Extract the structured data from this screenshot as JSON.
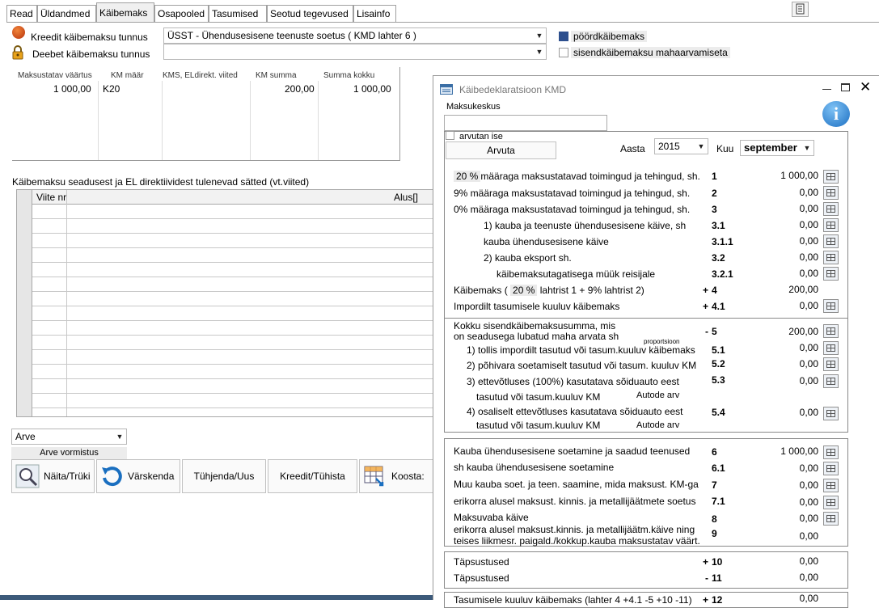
{
  "tabs": [
    "Read",
    "Üldandmed",
    "Käibemaks",
    "Osapooled",
    "Tasumised",
    "Seotud tegevused",
    "Lisainfo"
  ],
  "tax": {
    "credit_label": "Kreedit käibemaksu tunnus",
    "debit_label": "Deebet käibemaksu tunnus",
    "credit_value": "ÜSST - Ühendusesisene teenuste soetus ( KMD lahter 6 )",
    "debit_value": "",
    "reverse_label": "pöördkäibemaks",
    "reverse_checked": true,
    "input_vat_label": "sisendkäibemaksu mahaarvamiseta",
    "input_vat_checked": false
  },
  "vat_table": {
    "headers": [
      "Maksustatav väärtus",
      "KM määr",
      "KMS, ELdirekt. viited",
      "KM summa",
      "Summa kokku"
    ],
    "row": [
      "1 000,00",
      "K20",
      "",
      "200,00",
      "1 000,00"
    ]
  },
  "law": {
    "title": "Käibemaksu seadusest ja EL direktiividest tulenevad sätted (vt.viited)",
    "col_ref": "Viite nr",
    "col_basis": "Alus[]"
  },
  "footer": {
    "type_value": "Arve",
    "format_label": "Arve vormistus",
    "buttons": [
      "Näita/Trüki",
      "Värskenda",
      "Tühjenda/Uus",
      "Kreedit/Tühista",
      "Koosta:"
    ]
  },
  "dialog": {
    "title": "Käibedeklaratsioon KMD",
    "center_label": "Maksukeskus",
    "center_value": "",
    "self_calc_label": "arvutan ise",
    "calc_button": "Arvuta",
    "year_label": "Aasta",
    "year_value": "2015",
    "month_label": "Kuu",
    "month_value": "september",
    "rows1": [
      {
        "pre": "20 %",
        "label": "määraga maksustatavad toimingud ja tehingud, sh.",
        "code": "1",
        "value": "1 000,00"
      },
      {
        "pre": "",
        "label": "9% määraga maksustatavad toimingud ja tehingud, sh.",
        "code": "2",
        "value": "0,00"
      },
      {
        "pre": "",
        "label": "0% määraga maksustatavad toimingud ja tehingud, sh.",
        "code": "3",
        "value": "0,00"
      },
      {
        "pre": "",
        "label": "1) kauba ja teenuste ühendusesisene käive, sh",
        "code": "3.1",
        "value": "0,00"
      },
      {
        "pre": "",
        "label": "kauba ühendusesisene käive",
        "code": "3.1.1",
        "value": "0,00"
      },
      {
        "pre": "",
        "label": "2) kauba eksport sh.",
        "code": "3.2",
        "value": "0,00"
      },
      {
        "pre": "",
        "label": "käibemaksutagatisega müük reisijale",
        "code": "3.2.1",
        "value": "0,00"
      }
    ],
    "vat_line": {
      "pre": "Käibemaks (",
      "pct": "20 %",
      "post": "lahtrist 1 + 9% lahtrist 2)",
      "sign": "+",
      "code": "4",
      "value": "200,00"
    },
    "import_line": {
      "label": "Impordilt tasumisele kuuluv käibemaks",
      "sign": "+",
      "code": "4.1",
      "value": "0,00"
    },
    "input_total": {
      "label1": "Kokku sisendkäibemaksusumma, mis",
      "label2": "on seadusega lubatud maha arvata sh",
      "proportion": "proportsioon",
      "sign": "-",
      "code": "5",
      "value": "200,00"
    },
    "rows5": [
      {
        "label": "1) tollis impordilt tasutud või tasum.kuuluv käibemaks",
        "code": "5.1",
        "value": "0,00"
      },
      {
        "label": "2) põhivara soetamiselt tasutud või tasum. kuuluv KM",
        "code": "5.2",
        "value": "0,00"
      },
      {
        "label": "3) ettevõtluses (100%) kasutatava sõiduauto eest",
        "label2": "tasutud või tasum.kuuluv KM",
        "extra": "Autode arv",
        "code": "5.3",
        "value": "0,00"
      },
      {
        "label": "4) osaliselt ettevõtluses kasutatava sõiduauto eest",
        "label2": "tasutud või tasum.kuuluv KM",
        "extra": "Autode arv",
        "code": "5.4",
        "value": "0,00"
      }
    ],
    "rows6": [
      {
        "label": "Kauba ühendusesisene soetamine ja saadud teenused",
        "code": "6",
        "value": "1 000,00"
      },
      {
        "label": "sh kauba ühendusesisene soetamine",
        "code": "6.1",
        "value": "0,00"
      },
      {
        "label": "Muu kauba soet. ja teen. saamine, mida maksust. KM-ga",
        "code": "7",
        "value": "0,00"
      },
      {
        "label": "erikorra alusel maksust. kinnis. ja metallijäätmete soetus",
        "code": "7.1",
        "value": "0,00"
      },
      {
        "label": "Maksuvaba käive",
        "code": "8",
        "value": "0,00"
      },
      {
        "label": "erikorra alusel maksust.kinnis. ja metallijäätm.käive ning",
        "label2": "teises liikmesr. paigald./kokkup.kauba maksustatav väärt.",
        "code": "9",
        "value": "0,00"
      }
    ],
    "rows10": [
      {
        "label": "Täpsustused",
        "sign": "+",
        "code": "10",
        "value": "0,00"
      },
      {
        "label": "Täpsustused",
        "sign": "-",
        "code": "11",
        "value": "0,00"
      }
    ],
    "last_line": {
      "label": "Tasumisele kuuluv käibemaks (lahter 4 +4.1 -5 +10 -11)",
      "sign": "+",
      "code": "12",
      "value": "0,00"
    }
  }
}
